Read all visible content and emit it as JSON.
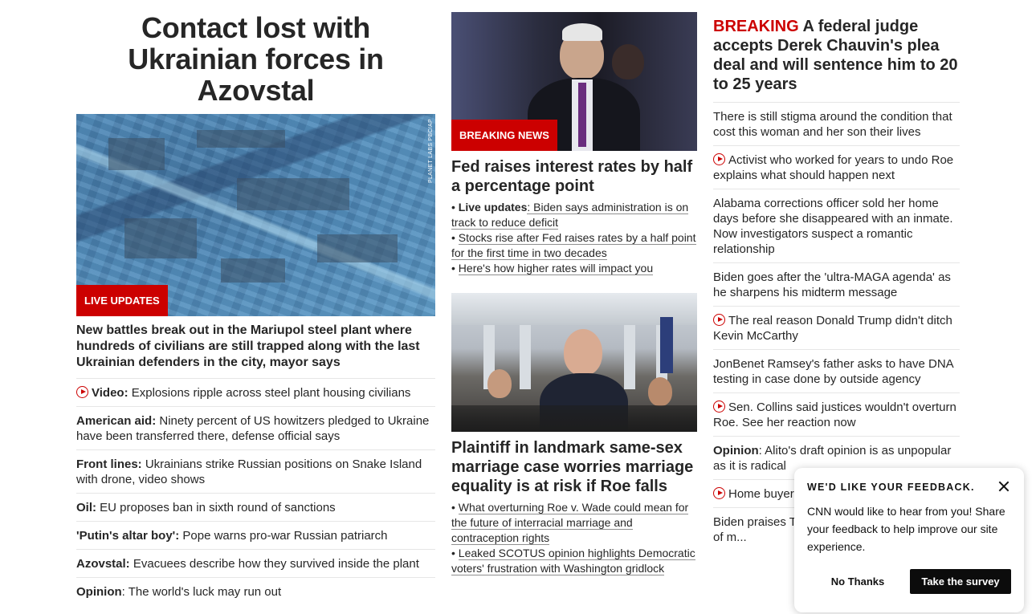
{
  "col1": {
    "headline": "Contact lost with Ukrainian forces in Azovstal",
    "image_credit": "PLANET LABS PBC/AP",
    "tag": "LIVE UPDATES",
    "lead": "New battles break out in the Mariupol steel plant where hundreds of civilians are still trapped along with the last Ukrainian defenders in the city, mayor says",
    "items": [
      {
        "label": "Video:",
        "text": " Explosions ripple across steel plant housing civilians",
        "icon": "play-icon"
      },
      {
        "label": "American aid:",
        "text": " Ninety percent of US howitzers pledged to Ukraine have been transferred there, defense official says"
      },
      {
        "label": "Front lines:",
        "text": " Ukrainians strike Russian positions on Snake Island with drone, video shows"
      },
      {
        "label": "Oil:",
        "text": " EU proposes ban in sixth round of sanctions"
      },
      {
        "label": "'Putin's altar boy':",
        "text": " Pope warns pro-war Russian patriarch"
      },
      {
        "label": "Azovstal:",
        "text": " Evacuees describe how they survived inside the plant"
      },
      {
        "label": "Opinion",
        "text": ": The world's luck may run out"
      }
    ]
  },
  "col2": {
    "story1": {
      "tag": "BREAKING NEWS",
      "headline": "Fed raises interest rates by half a percentage point",
      "bullets": [
        {
          "bold": "Live updates",
          "text": ": Biden says administration is on track to reduce deficit"
        },
        {
          "bold": "",
          "text": "Stocks rise after Fed raises rates by a half point for the first time in two decades"
        },
        {
          "bold": "",
          "text": "Here's how higher rates will impact you"
        }
      ]
    },
    "story2": {
      "headline": "Plaintiff in landmark same-sex marriage case worries marriage equality is at risk if Roe falls",
      "bullets": [
        {
          "text": "What overturning Roe v. Wade could mean for the future of interracial marriage and contraception rights"
        },
        {
          "text": "Leaked SCOTUS opinion highlights Democratic voters' frustration with Washington gridlock"
        }
      ]
    }
  },
  "col3": {
    "breaking_label": "BREAKING",
    "breaking_text": " A federal judge accepts Derek Chauvin's plea deal and will sentence him to 20 to 25 years",
    "items": [
      {
        "text": "There is still stigma around the condition that cost this woman and her son their lives"
      },
      {
        "text": "Activist who worked for years to undo Roe explains what should happen next",
        "icon": "play-icon"
      },
      {
        "text": "Alabama corrections officer sold her home days before she disappeared with an inmate. Now investigators suspect a romantic relationship"
      },
      {
        "text": "Biden goes after the 'ultra-MAGA agenda' as he sharpens his midterm message"
      },
      {
        "text": "The real reason Donald Trump didn't ditch Kevin McCarthy",
        "icon": "play-icon"
      },
      {
        "text": "JonBenet Ramsey's father asks to have DNA testing in case done by outside agency"
      },
      {
        "text": "Sen. Collins said justices wouldn't overturn Roe. See her reaction now",
        "icon": "play-icon"
      },
      {
        "bold": "Opinion",
        "text": ": Alito's draft opinion is as unpopular as it is radical"
      },
      {
        "text": "Home buyer... what they're do...",
        "icon": "play-icon"
      },
      {
        "text": "Biden praises T... visit since pand... your state of m..."
      }
    ]
  },
  "feedback": {
    "title": "WE'D LIKE YOUR FEEDBACK.",
    "body": "CNN would like to hear from you! Share your feedback to help improve our site experience.",
    "no_label": "No Thanks",
    "yes_label": "Take the survey"
  },
  "colors": {
    "accent_red": "#cc0000",
    "text": "#262626",
    "divider": "#e6e6e6"
  }
}
